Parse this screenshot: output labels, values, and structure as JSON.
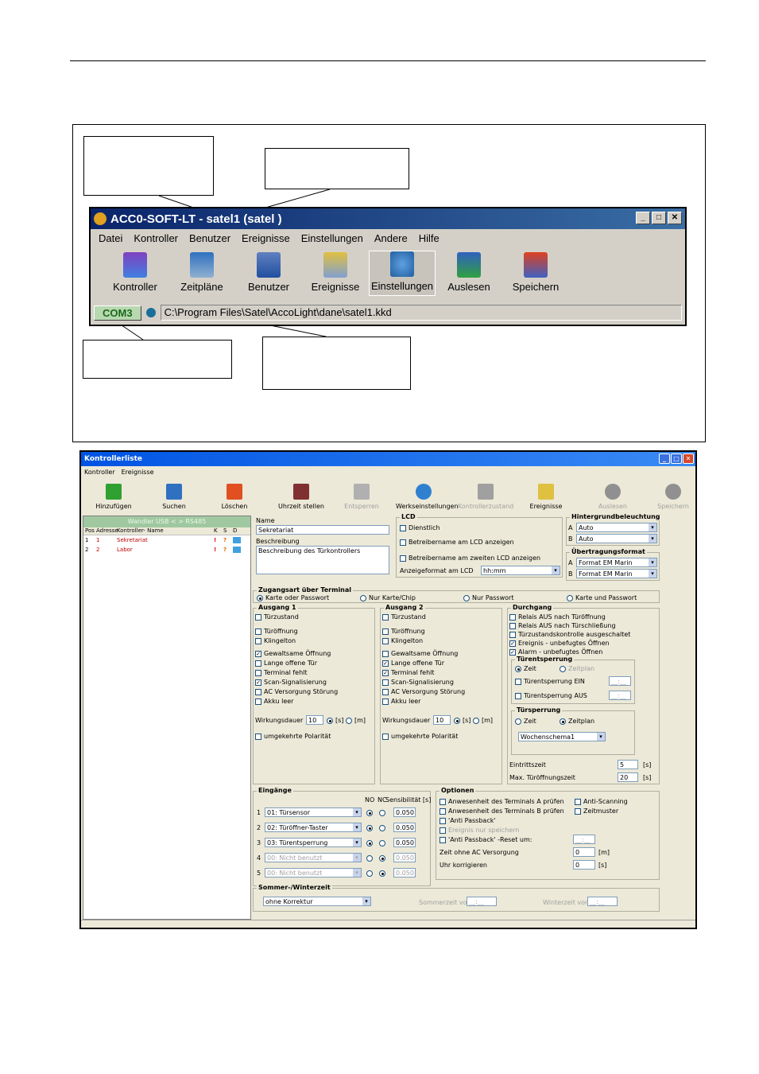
{
  "top_window": {
    "title": "ACC0-SOFT-LT - satel1 (satel )",
    "menu": [
      "Datei",
      "Kontroller",
      "Benutzer",
      "Ereignisse",
      "Einstellungen",
      "Andere",
      "Hilfe"
    ],
    "toolbar": [
      "Kontroller",
      "Zeitpläne",
      "Benutzer",
      "Ereignisse",
      "Einstellungen",
      "Auslesen",
      "Speichern"
    ],
    "com_port": "COM3",
    "path": "C:\\Program Files\\Satel\\AccoLight\\dane\\satel1.kkd"
  },
  "bottom_window": {
    "title": "Kontrollerliste",
    "menu": [
      "Kontroller",
      "Ereignisse"
    ],
    "toolbar": [
      "Hinzufügen",
      "Suchen",
      "Löschen",
      "Uhrzeit stellen",
      "Entsperren",
      "Werkseinstellungen",
      "Kontrollerzustand",
      "Ereignisse",
      "Auslesen",
      "Speichern"
    ],
    "wandler": "Wandler USB < > RS485",
    "list_header": [
      "Pos",
      "Adresse",
      "Kontroller- Name",
      "K",
      "S",
      "D"
    ],
    "list_rows": [
      {
        "pos": "1",
        "addr": "1",
        "name": "Sekretariat"
      },
      {
        "pos": "2",
        "addr": "2",
        "name": "Labor"
      }
    ],
    "name_label": "Name",
    "name_value": "Sekretariat",
    "desc_label": "Beschreibung",
    "desc_value": "Beschreibung des Türkontrollers",
    "lcd": {
      "title": "LCD",
      "items": [
        "Dienstlich",
        "Betreibername am LCD anzeigen",
        "Betreibername am zweiten LCD anzeigen"
      ],
      "format_label": "Anzeigeformat am LCD",
      "format_value": "hh:mm"
    },
    "backlight": {
      "title": "Hintergrundbeleuchtung",
      "a": "Auto",
      "b": "Auto"
    },
    "transfer": {
      "title": "Übertragungsformat",
      "a": "Format EM Marin",
      "b": "Format EM Marin"
    },
    "access": {
      "title": "Zugangsart über Terminal",
      "options": [
        "Karte oder Passwort",
        "Nur Karte/Chip",
        "Nur Passwort",
        "Karte und Passwort"
      ]
    },
    "output1": {
      "title": "Ausgang 1",
      "items": [
        "Türzustand",
        "Türöffnung",
        "Klingelton",
        "Gewaltsame Öffnung",
        "Lange offene Tür",
        "Terminal fehlt",
        "Scan-Signalisierung",
        "AC Versorgung Störung",
        "Akku leer"
      ],
      "checked": [
        false,
        false,
        false,
        true,
        false,
        false,
        true,
        false,
        false
      ],
      "duration_label": "Wirkungsdauer",
      "duration_value": "10",
      "s": "[s]",
      "m": "[m]",
      "polarity": "umgekehrte Polarität"
    },
    "output2": {
      "title": "Ausgang 2",
      "items": [
        "Türzustand",
        "Türöffnung",
        "Klingelton",
        "Gewaltsame Öffnung",
        "Lange offene Tür",
        "Terminal fehlt",
        "Scan-Signalisierung",
        "AC Versorgung Störung",
        "Akku leer"
      ],
      "checked": [
        false,
        false,
        false,
        false,
        true,
        true,
        false,
        false,
        false
      ],
      "duration_label": "Wirkungsdauer",
      "duration_value": "10",
      "s": "[s]",
      "m": "[m]",
      "polarity": "umgekehrte Polarität"
    },
    "passage": {
      "title": "Durchgang",
      "items": [
        "Relais AUS nach Türöffnung",
        "Relais AUS nach Türschließung",
        "Türzustandskontrolle ausgeschaltet",
        "Ereignis - unbefugtes Öffnen",
        "Alarm - unbefugtes Öffnen"
      ],
      "checked": [
        false,
        false,
        false,
        true,
        true
      ],
      "lock_title": "Türentsperrung",
      "zeit": "Zeit",
      "zeitplan": "Zeitplan",
      "lock_on": "Türentsperrung EIN",
      "lock_off": "Türentsperrung AUS",
      "time_placeholder": "__:__",
      "block_title": "Türsperrung",
      "schema": "Wochenschema1",
      "entry_label": "Eintrittszeit",
      "entry_value": "5",
      "max_label": "Max. Türöffnungszeit",
      "max_value": "20",
      "unit": "[s]"
    },
    "inputs": {
      "title": "Eingänge",
      "header": [
        "NO",
        "NC",
        "Sensibilität [s]"
      ],
      "rows": [
        {
          "n": "1",
          "name": "01: Türsensor",
          "val": "0.050"
        },
        {
          "n": "2",
          "name": "02: Türöffner-Taster",
          "val": "0.050"
        },
        {
          "n": "3",
          "name": "03: Türentsperrung",
          "val": "0.050"
        },
        {
          "n": "4",
          "name": "00: Nicht benutzt",
          "val": "0.050"
        },
        {
          "n": "5",
          "name": "00: Nicht benutzt",
          "val": "0.050"
        }
      ]
    },
    "options": {
      "title": "Optionen",
      "items": [
        "Anwesenheit des Terminals A prüfen",
        "Anwesenheit des Terminals B prüfen",
        "'Anti Passback'",
        "Ereignis nur speichern",
        "'Anti Passback' -Reset um:"
      ],
      "right": [
        "Anti-Scanning",
        "Zeitmuster"
      ],
      "ac_label": "Zeit ohne AC Versorgung",
      "ac_value": "0",
      "ac_unit": "[m]",
      "clock_label": "Uhr korrigieren",
      "clock_value": "0",
      "clock_unit": "[s]",
      "reset_placeholder": "__:__"
    },
    "dst": {
      "title": "Sommer-/Winterzeit",
      "value": "ohne Korrektur",
      "summer": "Sommerzeit von:",
      "winter": "Winterzeit von:",
      "summer_placeholder": "__:__",
      "winter_placeholder": "__:__"
    }
  }
}
